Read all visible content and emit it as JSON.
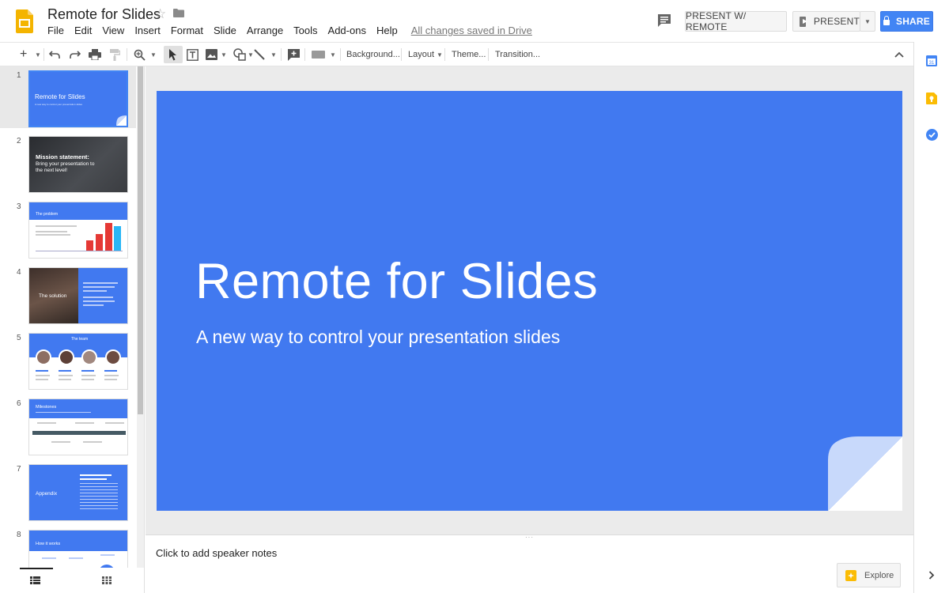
{
  "app": {
    "doc_title": "Remote for Slides",
    "saved_status": "All changes saved in Drive"
  },
  "menu": [
    "File",
    "Edit",
    "View",
    "Insert",
    "Format",
    "Slide",
    "Arrange",
    "Tools",
    "Add-ons",
    "Help"
  ],
  "header_buttons": {
    "present_remote": "PRESENT W/ REMOTE",
    "present": "PRESENT",
    "share": "SHARE"
  },
  "toolbar": {
    "background": "Background...",
    "layout": "Layout",
    "theme": "Theme...",
    "transition": "Transition..."
  },
  "slides": [
    {
      "num": "1",
      "title": "Remote for Slides",
      "subtitle": "A new way to control your presentation slides"
    },
    {
      "num": "2",
      "title": "Mission statement:",
      "body": "Bring your presentation to the next level!"
    },
    {
      "num": "3",
      "title": "The problem"
    },
    {
      "num": "4",
      "title": "The solution"
    },
    {
      "num": "5",
      "title": "The team"
    },
    {
      "num": "6",
      "title": "Milestones"
    },
    {
      "num": "7",
      "title": "Appendix"
    },
    {
      "num": "8",
      "title": "How it works"
    }
  ],
  "main_slide": {
    "title": "Remote for Slides",
    "subtitle": "A new way to control your presentation slides"
  },
  "notes": {
    "placeholder": "Click to add speaker notes"
  },
  "explore": {
    "label": "Explore"
  },
  "colors": {
    "slide_blue": "#4179f0",
    "share_blue": "#4285f4",
    "slides_yellow": "#f4b400"
  }
}
